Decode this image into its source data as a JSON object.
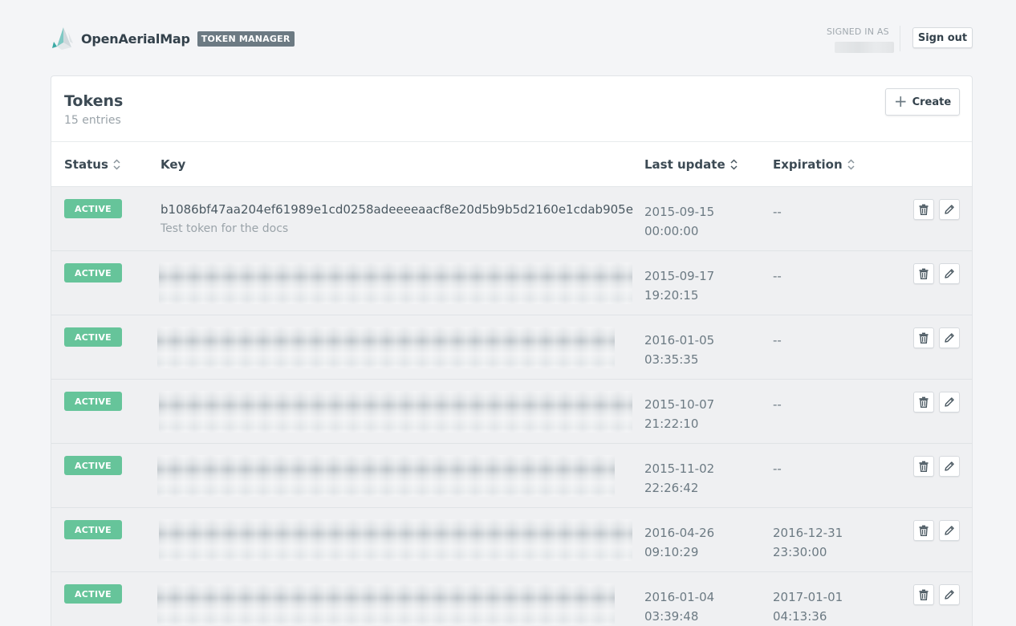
{
  "header": {
    "brand_name": "OpenAerialMap",
    "brand_badge": "TOKEN MANAGER",
    "signed_in_label": "SIGNED IN AS",
    "signout_label": "Sign out"
  },
  "panel": {
    "title": "Tokens",
    "subtitle": "15 entries",
    "create_label": "Create"
  },
  "table": {
    "columns": {
      "status": "Status",
      "key": "Key",
      "last_update": "Last update",
      "expiration": "Expiration"
    },
    "rows": [
      {
        "status": "ACTIVE",
        "key": "b1086bf47aa204ef61989e1cd0258adeeeeaacf8e20d5b9b5d2160e1cdab905e",
        "description": "Test token for the docs",
        "date": "2015-09-15",
        "time": "00:00:00",
        "exp_date": "--",
        "exp_time": ""
      },
      {
        "status": "ACTIVE",
        "key": "",
        "description": "",
        "date": "2015-09-17",
        "time": "19:20:15",
        "exp_date": "--",
        "exp_time": ""
      },
      {
        "status": "ACTIVE",
        "key": "",
        "description": "",
        "date": "2016-01-05",
        "time": "03:35:35",
        "exp_date": "--",
        "exp_time": ""
      },
      {
        "status": "ACTIVE",
        "key": "",
        "description": "",
        "date": "2015-10-07",
        "time": "21:22:10",
        "exp_date": "--",
        "exp_time": ""
      },
      {
        "status": "ACTIVE",
        "key": "",
        "description": "",
        "date": "2015-11-02",
        "time": "22:26:42",
        "exp_date": "--",
        "exp_time": ""
      },
      {
        "status": "ACTIVE",
        "key": "",
        "description": "",
        "date": "2016-04-26",
        "time": "09:10:29",
        "exp_date": "2016-12-31",
        "exp_time": "23:30:00"
      },
      {
        "status": "ACTIVE",
        "key": "",
        "description": "",
        "date": "2016-01-04",
        "time": "03:39:48",
        "exp_date": "2017-01-01",
        "exp_time": "04:13:36"
      }
    ]
  },
  "colors": {
    "active_badge": "#66c49a",
    "brand_badge": "#6c7a83",
    "page_bg": "#f4f5f7"
  },
  "icons": {
    "logo": "openaerialmap-logo",
    "sort": "sort-icon",
    "create": "plus-icon",
    "delete": "trash-icon",
    "edit": "pencil-icon"
  }
}
